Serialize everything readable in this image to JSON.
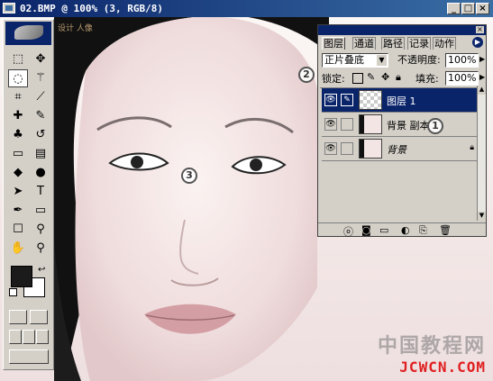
{
  "window": {
    "title": "02.BMP @ 100% (3, RGB/8)",
    "min": "_",
    "max": "□",
    "close": "×"
  },
  "canvas_side_text": "设计 人像",
  "toolbox": {
    "tools": [
      {
        "name": "marquee-tool",
        "glyph": "⬚"
      },
      {
        "name": "move-tool",
        "glyph": "✥"
      },
      {
        "name": "lasso-tool",
        "glyph": "◌"
      },
      {
        "name": "magic-wand-tool",
        "glyph": "⚚"
      },
      {
        "name": "crop-tool",
        "glyph": "⌗"
      },
      {
        "name": "slice-tool",
        "glyph": "⟋"
      },
      {
        "name": "healing-brush-tool",
        "glyph": "✚"
      },
      {
        "name": "brush-tool",
        "glyph": "✎"
      },
      {
        "name": "clone-stamp-tool",
        "glyph": "♣"
      },
      {
        "name": "history-brush-tool",
        "glyph": "↺"
      },
      {
        "name": "eraser-tool",
        "glyph": "▭"
      },
      {
        "name": "gradient-tool",
        "glyph": "▤"
      },
      {
        "name": "blur-tool",
        "glyph": "◆"
      },
      {
        "name": "dodge-tool",
        "glyph": "●"
      },
      {
        "name": "path-selection-tool",
        "glyph": "➤"
      },
      {
        "name": "type-tool",
        "glyph": "T"
      },
      {
        "name": "pen-tool",
        "glyph": "✒"
      },
      {
        "name": "rectangle-tool",
        "glyph": "▭"
      },
      {
        "name": "notes-tool",
        "glyph": "☐"
      },
      {
        "name": "eyedropper-tool",
        "glyph": "⚲"
      },
      {
        "name": "hand-tool",
        "glyph": "✋"
      },
      {
        "name": "zoom-tool",
        "glyph": "⚲"
      }
    ],
    "foreground_color": "#1b1b1b",
    "background_color": "#ffffff"
  },
  "layers_panel": {
    "tabs": [
      "图层",
      "通道",
      "路径",
      "记录",
      "动作"
    ],
    "blend_mode": "正片叠底",
    "opacity_label": "不透明度:",
    "opacity_value": "100%",
    "lock_label": "锁定:",
    "fill_label": "填充:",
    "fill_value": "100%",
    "layers": [
      {
        "name": "图层 1",
        "selected": true,
        "visible": true
      },
      {
        "name": "背景 副本",
        "selected": false,
        "visible": true
      },
      {
        "name": "背景",
        "selected": false,
        "visible": true,
        "locked": true
      }
    ]
  },
  "annotations": [
    "2",
    "1",
    "3"
  ],
  "watermark": {
    "line1": "中国教程网",
    "line2": "JCWCN.COM"
  },
  "colors": {
    "title_bar": "#0a246a",
    "panel_bg": "#d4d0c8",
    "selection": "#0a246a",
    "watermark_red": "#e02020"
  }
}
